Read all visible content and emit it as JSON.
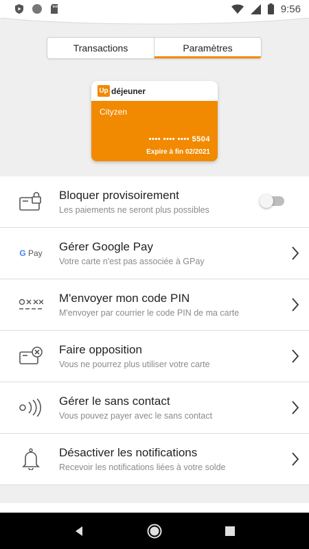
{
  "status_bar": {
    "time": "9:56"
  },
  "tabs": [
    {
      "label": "Transactions",
      "active": false
    },
    {
      "label": "Paramètres",
      "active": true
    }
  ],
  "card": {
    "logo": "Up",
    "brand": "déjeuner",
    "holder": "Cityzen",
    "number": "•••• •••• ••••  5504",
    "expiry_prefix": "Expire à fin",
    "expiry_date": "02/2021",
    "color": "#f18a00"
  },
  "settings": [
    {
      "icon": "card-lock-icon",
      "title": "Bloquer provisoirement",
      "subtitle": "Les paiements ne seront plus possibles",
      "control": "toggle",
      "toggle_on": false
    },
    {
      "icon": "gpay-icon",
      "icon_text": "G Pay",
      "title": "Gérer Google Pay",
      "subtitle": "Votre carte n'est pas associée à GPay",
      "control": "chevron"
    },
    {
      "icon": "pin-code-icon",
      "title": "M'envoyer mon code PIN",
      "subtitle": "M'envoyer par courrier le code PIN de ma carte",
      "control": "chevron"
    },
    {
      "icon": "card-cancel-icon",
      "title": "Faire opposition",
      "subtitle": "Vous ne pourrez plus utiliser votre carte",
      "control": "chevron"
    },
    {
      "icon": "contactless-icon",
      "title": "Gérer le sans contact",
      "subtitle": "Vous pouvez payer avec le sans contact",
      "control": "chevron"
    },
    {
      "icon": "bell-icon",
      "title": "Désactiver les notifications",
      "subtitle": "Recevoir les notifications liées à votre solde",
      "control": "chevron"
    }
  ],
  "nav": {
    "back": "back-icon",
    "home": "home-icon",
    "recents": "recents-icon"
  }
}
